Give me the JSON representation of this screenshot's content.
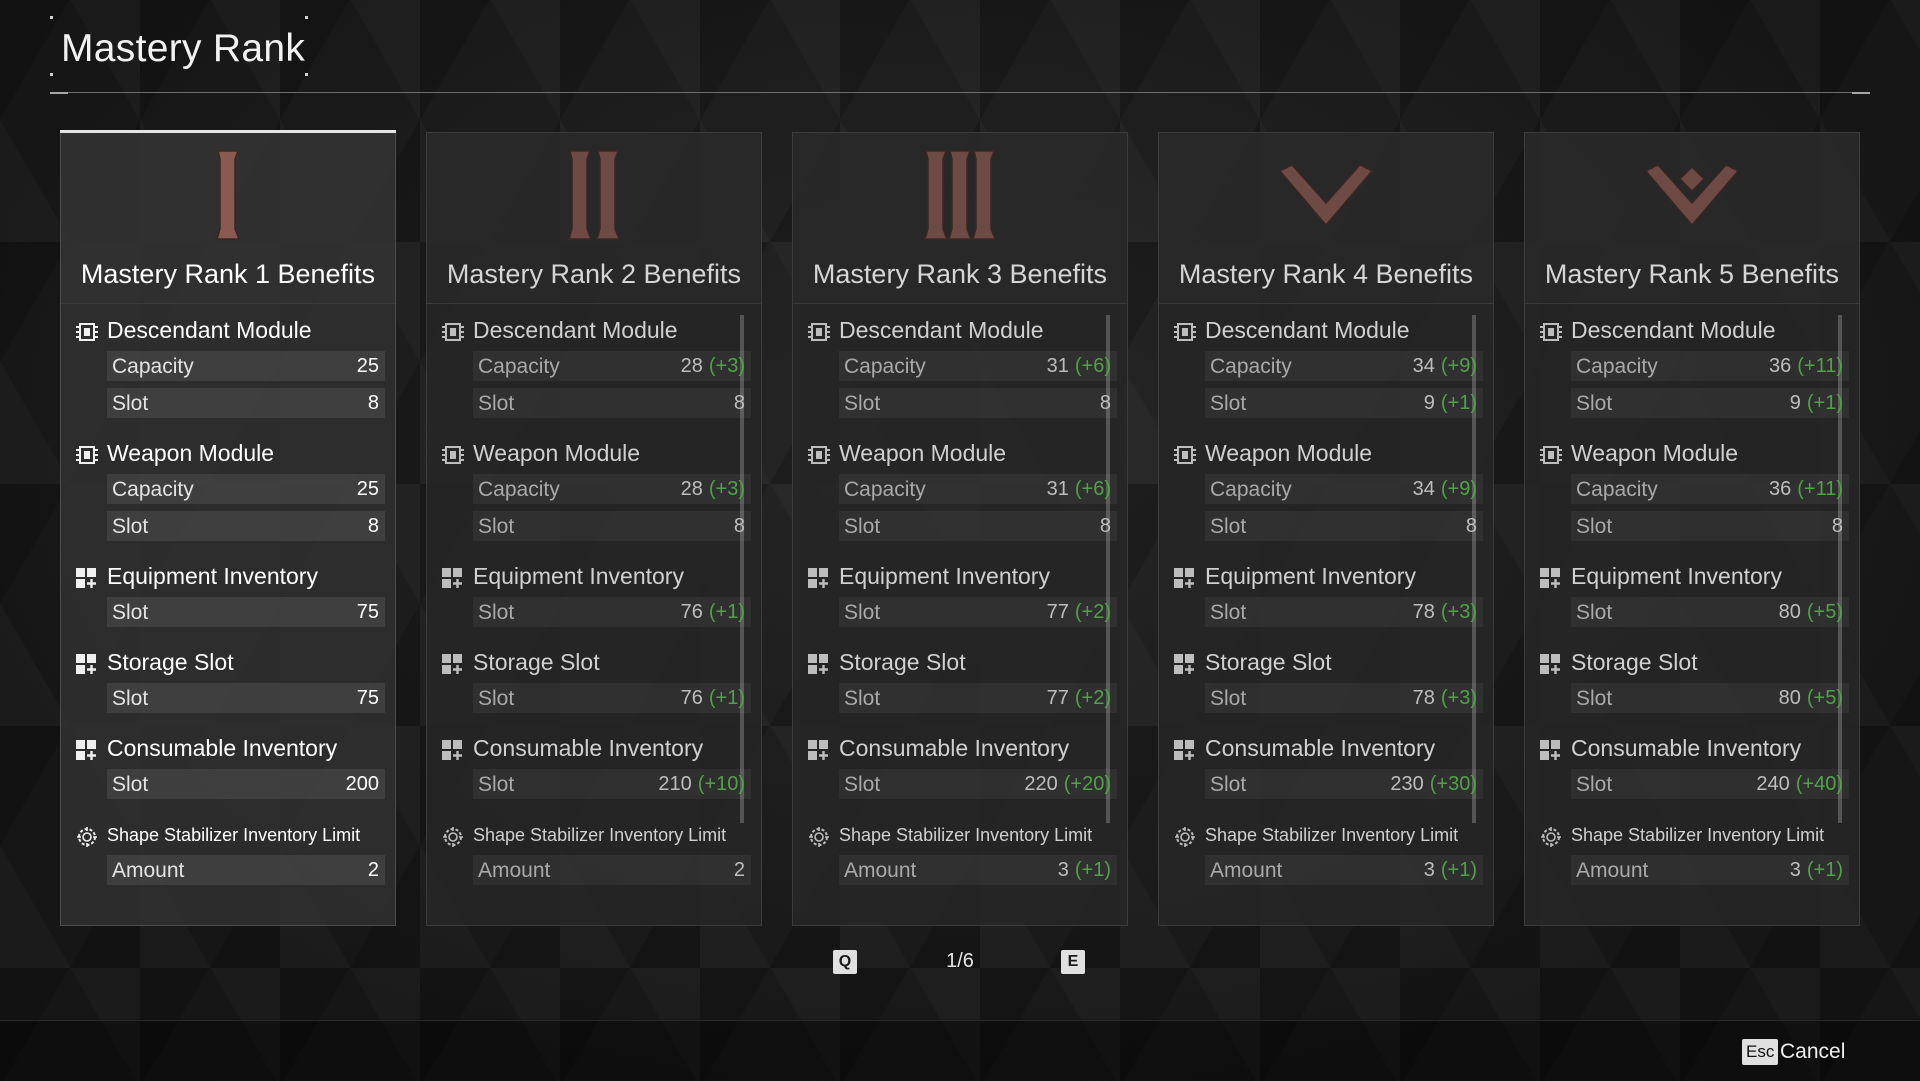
{
  "page_title": "Mastery Rank",
  "cards": [
    {
      "title": "Mastery Rank 1 Benefits",
      "emblem": "rank-1-emblem",
      "sections": [
        {
          "label": "Descendant Module",
          "icon": "module-chip-icon",
          "rows": [
            {
              "label": "Capacity",
              "value": "25",
              "delta": ""
            },
            {
              "label": "Slot",
              "value": "8",
              "delta": ""
            }
          ]
        },
        {
          "label": "Weapon Module",
          "icon": "module-chip-icon",
          "rows": [
            {
              "label": "Capacity",
              "value": "25",
              "delta": ""
            },
            {
              "label": "Slot",
              "value": "8",
              "delta": ""
            }
          ]
        },
        {
          "label": "Equipment Inventory",
          "icon": "inventory-grid-icon",
          "rows": [
            {
              "label": "Slot",
              "value": "75",
              "delta": ""
            }
          ]
        },
        {
          "label": "Storage Slot",
          "icon": "inventory-grid-icon",
          "rows": [
            {
              "label": "Slot",
              "value": "75",
              "delta": ""
            }
          ]
        },
        {
          "label": "Consumable Inventory",
          "icon": "inventory-grid-icon",
          "rows": [
            {
              "label": "Slot",
              "value": "200",
              "delta": ""
            }
          ]
        },
        {
          "label": "Shape Stabilizer Inventory Limit",
          "icon": "stabilizer-gear-icon",
          "rows": [
            {
              "label": "Amount",
              "value": "2",
              "delta": ""
            }
          ]
        }
      ]
    },
    {
      "title": "Mastery Rank 2 Benefits",
      "emblem": "rank-2-emblem",
      "sections": [
        {
          "label": "Descendant Module",
          "icon": "module-chip-icon",
          "rows": [
            {
              "label": "Capacity",
              "value": "28",
              "delta": "(+3)"
            },
            {
              "label": "Slot",
              "value": "8",
              "delta": ""
            }
          ]
        },
        {
          "label": "Weapon Module",
          "icon": "module-chip-icon",
          "rows": [
            {
              "label": "Capacity",
              "value": "28",
              "delta": "(+3)"
            },
            {
              "label": "Slot",
              "value": "8",
              "delta": ""
            }
          ]
        },
        {
          "label": "Equipment Inventory",
          "icon": "inventory-grid-icon",
          "rows": [
            {
              "label": "Slot",
              "value": "76",
              "delta": "(+1)"
            }
          ]
        },
        {
          "label": "Storage Slot",
          "icon": "inventory-grid-icon",
          "rows": [
            {
              "label": "Slot",
              "value": "76",
              "delta": "(+1)"
            }
          ]
        },
        {
          "label": "Consumable Inventory",
          "icon": "inventory-grid-icon",
          "rows": [
            {
              "label": "Slot",
              "value": "210",
              "delta": "(+10)"
            }
          ]
        },
        {
          "label": "Shape Stabilizer Inventory Limit",
          "icon": "stabilizer-gear-icon",
          "rows": [
            {
              "label": "Amount",
              "value": "2",
              "delta": ""
            }
          ]
        }
      ]
    },
    {
      "title": "Mastery Rank 3 Benefits",
      "emblem": "rank-3-emblem",
      "sections": [
        {
          "label": "Descendant Module",
          "icon": "module-chip-icon",
          "rows": [
            {
              "label": "Capacity",
              "value": "31",
              "delta": "(+6)"
            },
            {
              "label": "Slot",
              "value": "8",
              "delta": ""
            }
          ]
        },
        {
          "label": "Weapon Module",
          "icon": "module-chip-icon",
          "rows": [
            {
              "label": "Capacity",
              "value": "31",
              "delta": "(+6)"
            },
            {
              "label": "Slot",
              "value": "8",
              "delta": ""
            }
          ]
        },
        {
          "label": "Equipment Inventory",
          "icon": "inventory-grid-icon",
          "rows": [
            {
              "label": "Slot",
              "value": "77",
              "delta": "(+2)"
            }
          ]
        },
        {
          "label": "Storage Slot",
          "icon": "inventory-grid-icon",
          "rows": [
            {
              "label": "Slot",
              "value": "77",
              "delta": "(+2)"
            }
          ]
        },
        {
          "label": "Consumable Inventory",
          "icon": "inventory-grid-icon",
          "rows": [
            {
              "label": "Slot",
              "value": "220",
              "delta": "(+20)"
            }
          ]
        },
        {
          "label": "Shape Stabilizer Inventory Limit",
          "icon": "stabilizer-gear-icon",
          "rows": [
            {
              "label": "Amount",
              "value": "3",
              "delta": "(+1)"
            }
          ]
        }
      ]
    },
    {
      "title": "Mastery Rank 4 Benefits",
      "emblem": "rank-4-emblem",
      "sections": [
        {
          "label": "Descendant Module",
          "icon": "module-chip-icon",
          "rows": [
            {
              "label": "Capacity",
              "value": "34",
              "delta": "(+9)"
            },
            {
              "label": "Slot",
              "value": "9",
              "delta": "(+1)"
            }
          ]
        },
        {
          "label": "Weapon Module",
          "icon": "module-chip-icon",
          "rows": [
            {
              "label": "Capacity",
              "value": "34",
              "delta": "(+9)"
            },
            {
              "label": "Slot",
              "value": "8",
              "delta": ""
            }
          ]
        },
        {
          "label": "Equipment Inventory",
          "icon": "inventory-grid-icon",
          "rows": [
            {
              "label": "Slot",
              "value": "78",
              "delta": "(+3)"
            }
          ]
        },
        {
          "label": "Storage Slot",
          "icon": "inventory-grid-icon",
          "rows": [
            {
              "label": "Slot",
              "value": "78",
              "delta": "(+3)"
            }
          ]
        },
        {
          "label": "Consumable Inventory",
          "icon": "inventory-grid-icon",
          "rows": [
            {
              "label": "Slot",
              "value": "230",
              "delta": "(+30)"
            }
          ]
        },
        {
          "label": "Shape Stabilizer Inventory Limit",
          "icon": "stabilizer-gear-icon",
          "rows": [
            {
              "label": "Amount",
              "value": "3",
              "delta": "(+1)"
            }
          ]
        }
      ]
    },
    {
      "title": "Mastery Rank 5 Benefits",
      "emblem": "rank-5-emblem",
      "sections": [
        {
          "label": "Descendant Module",
          "icon": "module-chip-icon",
          "rows": [
            {
              "label": "Capacity",
              "value": "36",
              "delta": "(+11)"
            },
            {
              "label": "Slot",
              "value": "9",
              "delta": "(+1)"
            }
          ]
        },
        {
          "label": "Weapon Module",
          "icon": "module-chip-icon",
          "rows": [
            {
              "label": "Capacity",
              "value": "36",
              "delta": "(+11)"
            },
            {
              "label": "Slot",
              "value": "8",
              "delta": ""
            }
          ]
        },
        {
          "label": "Equipment Inventory",
          "icon": "inventory-grid-icon",
          "rows": [
            {
              "label": "Slot",
              "value": "80",
              "delta": "(+5)"
            }
          ]
        },
        {
          "label": "Storage Slot",
          "icon": "inventory-grid-icon",
          "rows": [
            {
              "label": "Slot",
              "value": "80",
              "delta": "(+5)"
            }
          ]
        },
        {
          "label": "Consumable Inventory",
          "icon": "inventory-grid-icon",
          "rows": [
            {
              "label": "Slot",
              "value": "240",
              "delta": "(+40)"
            }
          ]
        },
        {
          "label": "Shape Stabilizer Inventory Limit",
          "icon": "stabilizer-gear-icon",
          "rows": [
            {
              "label": "Amount",
              "value": "3",
              "delta": "(+1)"
            }
          ]
        }
      ]
    }
  ],
  "pager": {
    "prev_key": "Q",
    "next_key": "E",
    "page": "1/6"
  },
  "footer": {
    "cancel_key": "Esc",
    "cancel_label": "Cancel"
  },
  "colors": {
    "accent_green": "#52a04a",
    "emblem_copper": "#8a5a52",
    "background": "#1b1b1b"
  }
}
